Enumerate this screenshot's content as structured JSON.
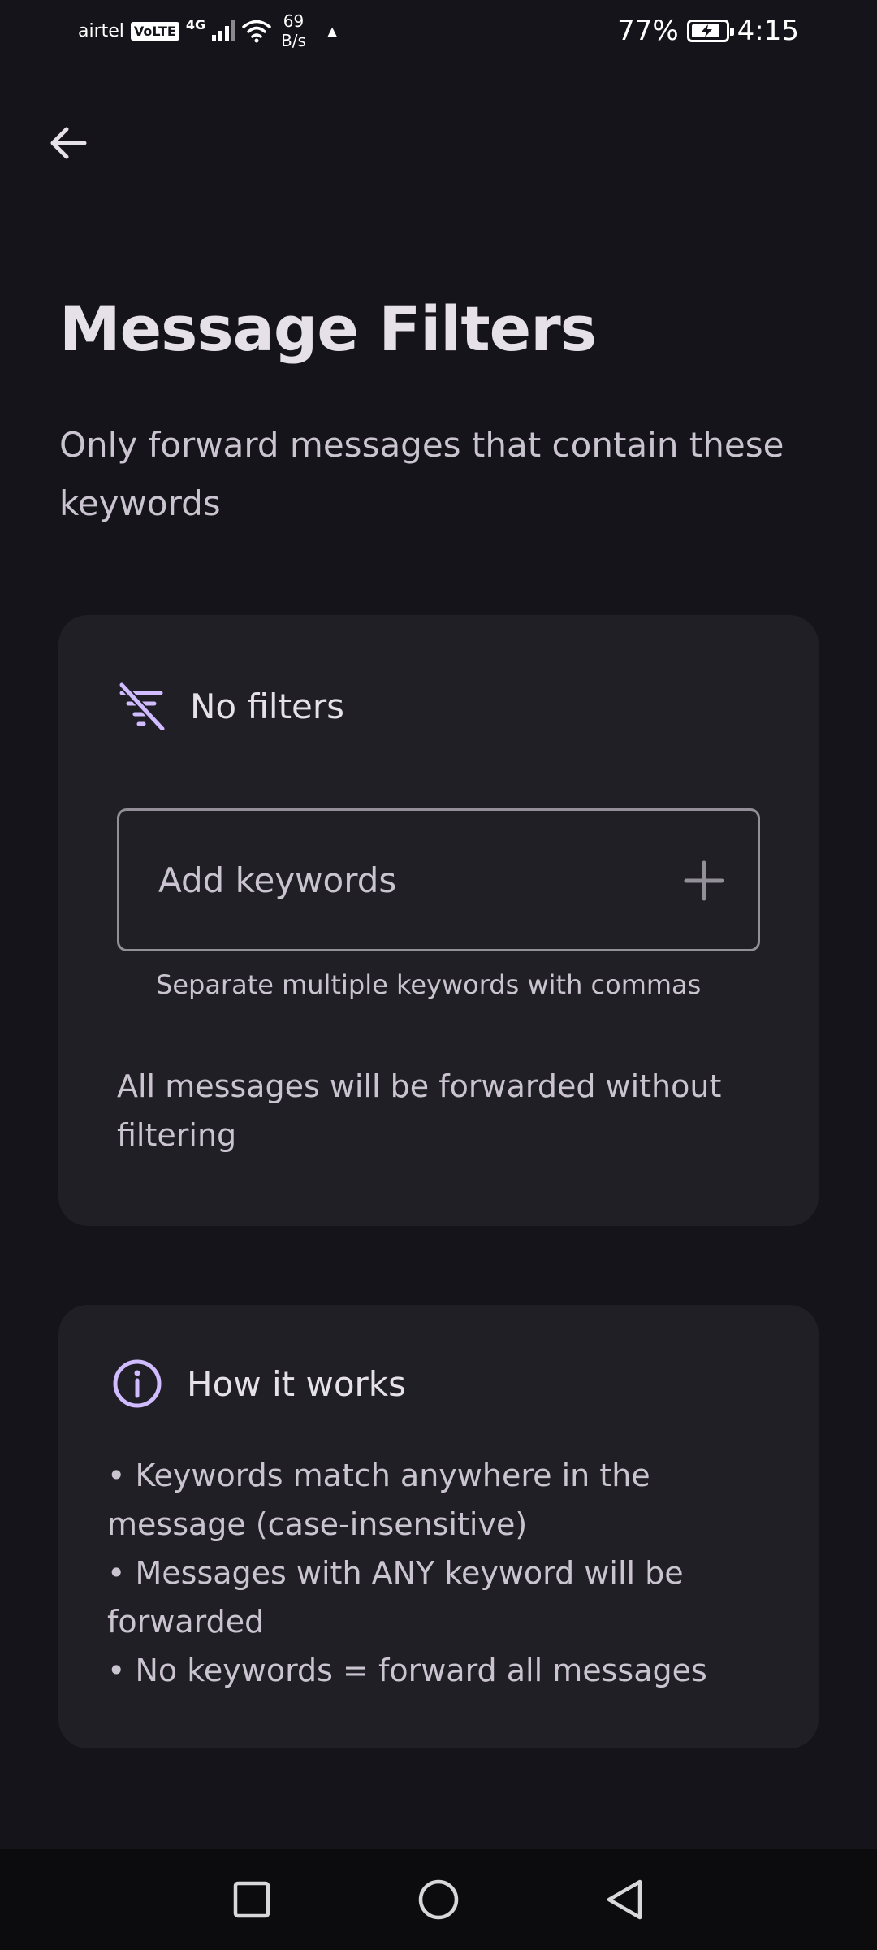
{
  "status_bar": {
    "carrier": "airtel",
    "volte": "VoLTE",
    "network": "4G",
    "speed_value": "69",
    "speed_unit": "B/s",
    "battery_percent": "77%",
    "time": "4:15"
  },
  "header": {
    "back_icon": "arrow-back-icon"
  },
  "page": {
    "title": "Message Filters",
    "subtitle": "Only forward messages that contain these keywords"
  },
  "filters": {
    "icon": "filter-off-icon",
    "status": "No filters",
    "input_placeholder": "Add keywords",
    "input_value": "",
    "add_icon": "plus-icon",
    "helper": "Separate multiple keywords with commas",
    "info": "All messages will be forwarded without filtering"
  },
  "how_it_works": {
    "icon": "info-icon",
    "title": "How it works",
    "bullets": [
      "• Keywords match anywhere in the message (case-insensitive)",
      "• Messages with ANY keyword will be forwarded",
      "• No keywords = forward all messages"
    ]
  },
  "colors": {
    "background": "#15141a",
    "card": "#211f26",
    "accent": "#d0bcff"
  }
}
